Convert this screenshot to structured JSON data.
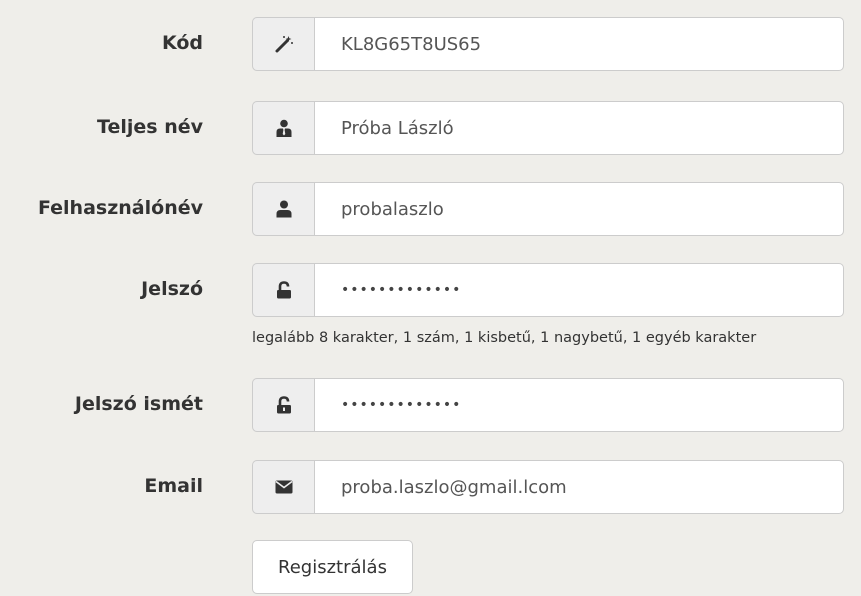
{
  "form": {
    "fields": [
      {
        "label": "Kód",
        "icon": "magic-wand-icon",
        "value": "KL8G65T8US65",
        "type": "text"
      },
      {
        "label": "Teljes név",
        "icon": "user-tie-icon",
        "value": "Próba László",
        "type": "text"
      },
      {
        "label": "Felhasználónév",
        "icon": "user-icon",
        "value": "probalaszlo",
        "type": "text"
      },
      {
        "label": "Jelszó",
        "icon": "unlock-icon",
        "value": "•••••••••••••",
        "type": "password"
      },
      {
        "label": "Jelszó ismét",
        "icon": "unlock-icon",
        "value": "•••••••••••••",
        "type": "password"
      },
      {
        "label": "Email",
        "icon": "envelope-icon",
        "value": "proba.laszlo@gmail.lcom",
        "type": "email"
      }
    ],
    "password_hint": "legalább 8 karakter, 1 szám, 1 kisbetű, 1 nagybetű, 1 egyéb karakter",
    "submit_label": "Regisztrálás"
  },
  "colors": {
    "panel_background": "#efeeea",
    "addon_background": "#eeeeee",
    "border": "#cccccc",
    "label_text": "#333333",
    "input_text": "#555555"
  }
}
